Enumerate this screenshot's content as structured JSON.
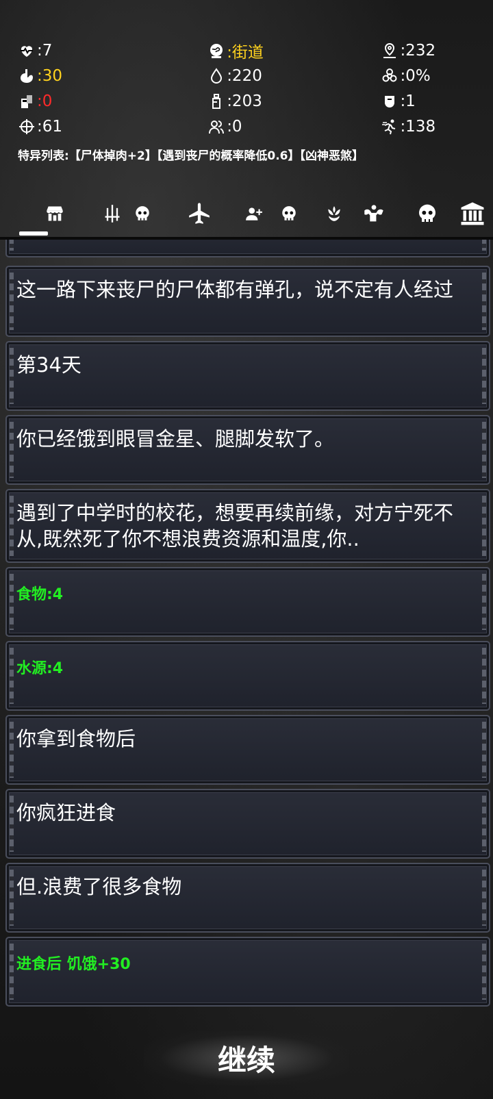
{
  "stats": {
    "health": ":7",
    "location": ":街道",
    "distance": ":232",
    "hunger": ":30",
    "water": ":220",
    "infection": ":0%",
    "item": ":0",
    "bottle": ":203",
    "armor": ":1",
    "accuracy": ":61",
    "companions": ":0",
    "kills": ":138"
  },
  "colors": {
    "yellow": "#ffd21e",
    "red": "#ff2a2a",
    "green": "#22ee22",
    "white": "#ffffff"
  },
  "traits": "特异列表:【尸体掉肉+2】【遇到丧尸的概率降低0.6】【凶神恶煞】",
  "tabs": [
    {
      "icon": "shop-icon"
    },
    {
      "icon": "weapons-icon"
    },
    {
      "icon": "skull-icon"
    },
    {
      "icon": "airplane-icon"
    },
    {
      "icon": "add-person-icon"
    },
    {
      "icon": "skull-icon"
    },
    {
      "icon": "lotus-icon"
    },
    {
      "icon": "strength-icon"
    },
    {
      "icon": "skull-icon"
    },
    {
      "icon": "bank-icon"
    }
  ],
  "log": [
    {
      "text": "这一路下来丧尸的尸体都有弹孔，说不定有人经过"
    },
    {
      "text": "第34天"
    },
    {
      "text": "你已经饿到眼冒金星、腿脚发软了。"
    },
    {
      "text": "遇到了中学时的校花，想要再续前缘，对方宁死不从,既然死了你不想浪费资源和温度,你.."
    },
    {
      "text": "食物:4"
    },
    {
      "text": "水源:4"
    },
    {
      "text": "你拿到食物后"
    },
    {
      "text": "你疯狂进食"
    },
    {
      "text": "但.浪费了很多食物"
    },
    {
      "text": "进食后 饥饿+30"
    }
  ],
  "continue_label": "继续"
}
